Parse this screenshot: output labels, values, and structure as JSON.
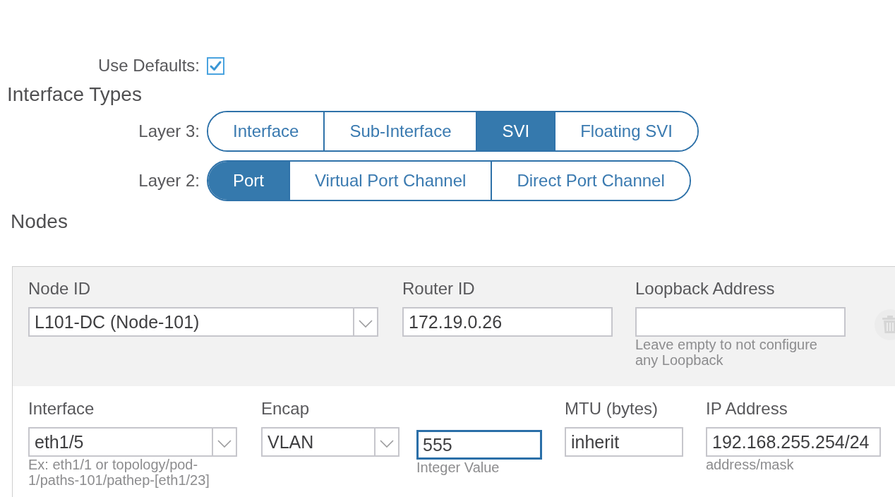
{
  "use_defaults": {
    "label": "Use Defaults:",
    "checked": true
  },
  "interface_types": {
    "title": "Interface Types",
    "groups": [
      {
        "label": "Layer 3:",
        "options": [
          {
            "label": "Interface",
            "selected": false
          },
          {
            "label": "Sub-Interface",
            "selected": false
          },
          {
            "label": "SVI",
            "selected": true
          },
          {
            "label": "Floating SVI",
            "selected": false
          }
        ]
      },
      {
        "label": "Layer 2:",
        "options": [
          {
            "label": "Port",
            "selected": true
          },
          {
            "label": "Virtual Port Channel",
            "selected": false
          },
          {
            "label": "Direct Port Channel",
            "selected": false
          }
        ]
      }
    ]
  },
  "nodes": {
    "title": "Nodes",
    "node_fields": [
      {
        "kind": "select",
        "label": "Node ID",
        "value": "L101-DC (Node-101)",
        "focused": false
      },
      {
        "kind": "text",
        "label": "Router ID",
        "value": "172.19.0.26",
        "focused": false
      },
      {
        "kind": "text",
        "label": "Loopback Address",
        "hint": "Leave empty to not configure any Loopback",
        "focused": false
      }
    ],
    "interface_fields": [
      {
        "kind": "select",
        "label": "Interface",
        "value": "eth1/5",
        "hint": "Ex: eth1/1 or topology/pod-1/paths-101/pathep-[eth1/23]",
        "focused": false
      },
      {
        "kind": "select",
        "label": "Encap",
        "value": "VLAN",
        "focused": false
      },
      {
        "kind": "text",
        "value": "555",
        "hint": "Integer Value",
        "focused": true
      },
      {
        "kind": "text",
        "label": "MTU (bytes)",
        "value": "inherit",
        "focused": false
      },
      {
        "kind": "text",
        "label": "IP Address",
        "value": "192.168.255.254/24",
        "hint": "address/mask",
        "focused": false
      }
    ]
  }
}
